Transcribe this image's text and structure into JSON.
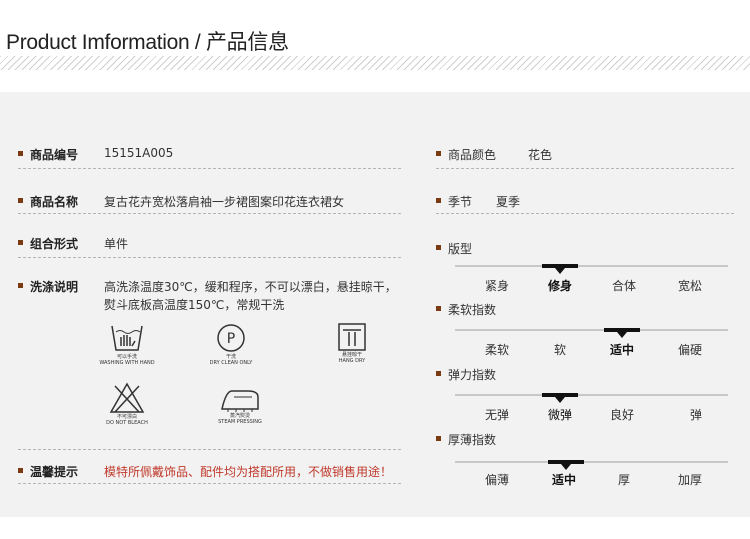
{
  "header": {
    "title": "Product Imformation / 产品信息"
  },
  "left": {
    "code_label": "商品编号",
    "code_value": "15151A005",
    "name_label": "商品名称",
    "name_value": "复古花卉宽松落肩袖一步裙图案印花连衣裙女",
    "combo_label": "组合形式",
    "combo_value": "单件",
    "wash_label": "洗涤说明",
    "wash_text": "高洗涤温度30℃，缓和程序，不可以漂白，悬挂晾干，熨斗底板高温度150℃，常规干洗",
    "care_icons": [
      {
        "icon": "hand-wash-icon",
        "text1": "可以手洗",
        "text2": "WASHING WITH HAND"
      },
      {
        "icon": "dry-clean-icon",
        "text1": "干洗",
        "text2": "DRY CLEAN ONLY"
      },
      {
        "icon": "hang-dry-icon",
        "text1": "悬挂晾干",
        "text2": "HANG DRY"
      },
      {
        "icon": "no-bleach-icon",
        "text1": "不可漂白",
        "text2": "DO NOT BLEACH"
      },
      {
        "icon": "steam-iron-icon",
        "text1": "蒸汽熨烫",
        "text2": "STEAM PRESSING"
      }
    ],
    "tip_label": "温馨提示",
    "tip_value": "模特所佩戴饰品、配件均为搭配所用，不做销售用途！"
  },
  "right": {
    "color_label": "商品颜色",
    "color_value": "花色",
    "season_label": "季节",
    "season_value": "夏季",
    "scales": [
      {
        "label": "版型",
        "options": [
          "紧身",
          "修身",
          "合体",
          "宽松"
        ],
        "selected": 1
      },
      {
        "label": "柔软指数",
        "options": [
          "柔软",
          "软",
          "适中",
          "偏硬"
        ],
        "selected": 2
      },
      {
        "label": "弹力指数",
        "options": [
          "无弹",
          "微弹",
          "良好",
          "弹"
        ],
        "selected": 1
      },
      {
        "label": "厚薄指数",
        "options": [
          "偏薄",
          "适中",
          "厚",
          "加厚"
        ],
        "selected": 1
      }
    ]
  },
  "colors": {
    "bullet": "#7a3b12",
    "warning": "#c0392b"
  }
}
